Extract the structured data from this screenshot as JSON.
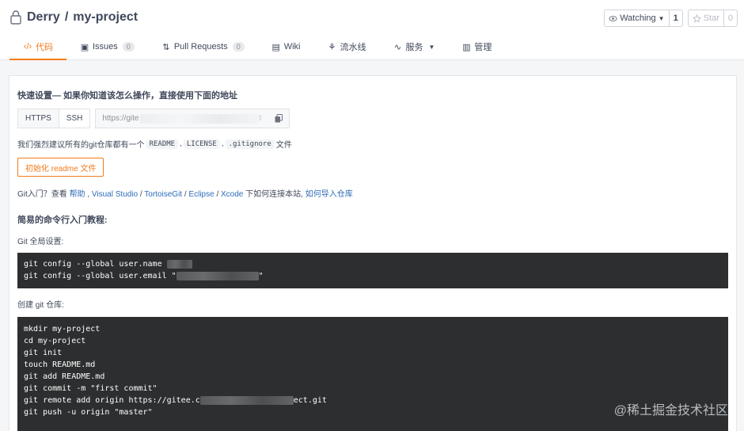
{
  "repo": {
    "owner": "Derry",
    "separator": "/",
    "name": "my-project"
  },
  "actions": {
    "watching_label": "Watching",
    "watching_count": "1",
    "star_label": "Star",
    "star_count": "0"
  },
  "tabs": [
    {
      "label": "代码",
      "icon": "code-icon",
      "active": true
    },
    {
      "label": "Issues",
      "badge": "0",
      "icon": "issues-icon"
    },
    {
      "label": "Pull Requests",
      "badge": "0",
      "icon": "pull-request-icon"
    },
    {
      "label": "Wiki",
      "icon": "wiki-icon"
    },
    {
      "label": "流水线",
      "icon": "pipeline-icon"
    },
    {
      "label": "服务",
      "icon": "service-icon",
      "dropdown": true
    },
    {
      "label": "管理",
      "icon": "manage-icon"
    }
  ],
  "setup": {
    "title": "快速设置— 如果你知道该怎么操作，直接使用下面的地址",
    "protocols": [
      "HTTPS",
      "SSH"
    ],
    "url_prefix": "https://gite",
    "url_suffix": "t",
    "suggest_prefix": "我们强烈建议所有的git仓库都有一个",
    "files": [
      "README",
      "LICENSE",
      ".gitignore"
    ],
    "suggest_suffix": "文件",
    "init_button": "初始化 readme 文件"
  },
  "intro": {
    "prefix": "Git入门？查看",
    "help": "帮助",
    "sep": ",",
    "vs": "Visual Studio",
    "slash": "/",
    "tortoise": "TortoiseGit",
    "eclipse": "Eclipse",
    "xcode": "Xcode",
    "middle": "下如何连接本站,",
    "import": "如何导入仓库"
  },
  "tutorial": {
    "title": "简易的命令行入门教程:",
    "global_label": "Git 全局设置:",
    "global_lines": [
      "git config --global user.name ",
      "git config --global user.email \""
    ],
    "global_email_end": "\"",
    "create_label": "创建 git 仓库:",
    "create_lines": [
      "mkdir my-project",
      "cd my-project",
      "git init",
      "touch README.md",
      "git add README.md",
      "git commit -m \"first commit\"",
      "git remote add origin https://gitee.c",
      "git push -u origin \"master\""
    ],
    "remote_end": "ect.git"
  },
  "watermark": "@稀土掘金技术社区",
  "colors": {
    "accent": "#f37b1d",
    "link": "#2e6cb8",
    "code_bg": "#2d2e2f"
  }
}
